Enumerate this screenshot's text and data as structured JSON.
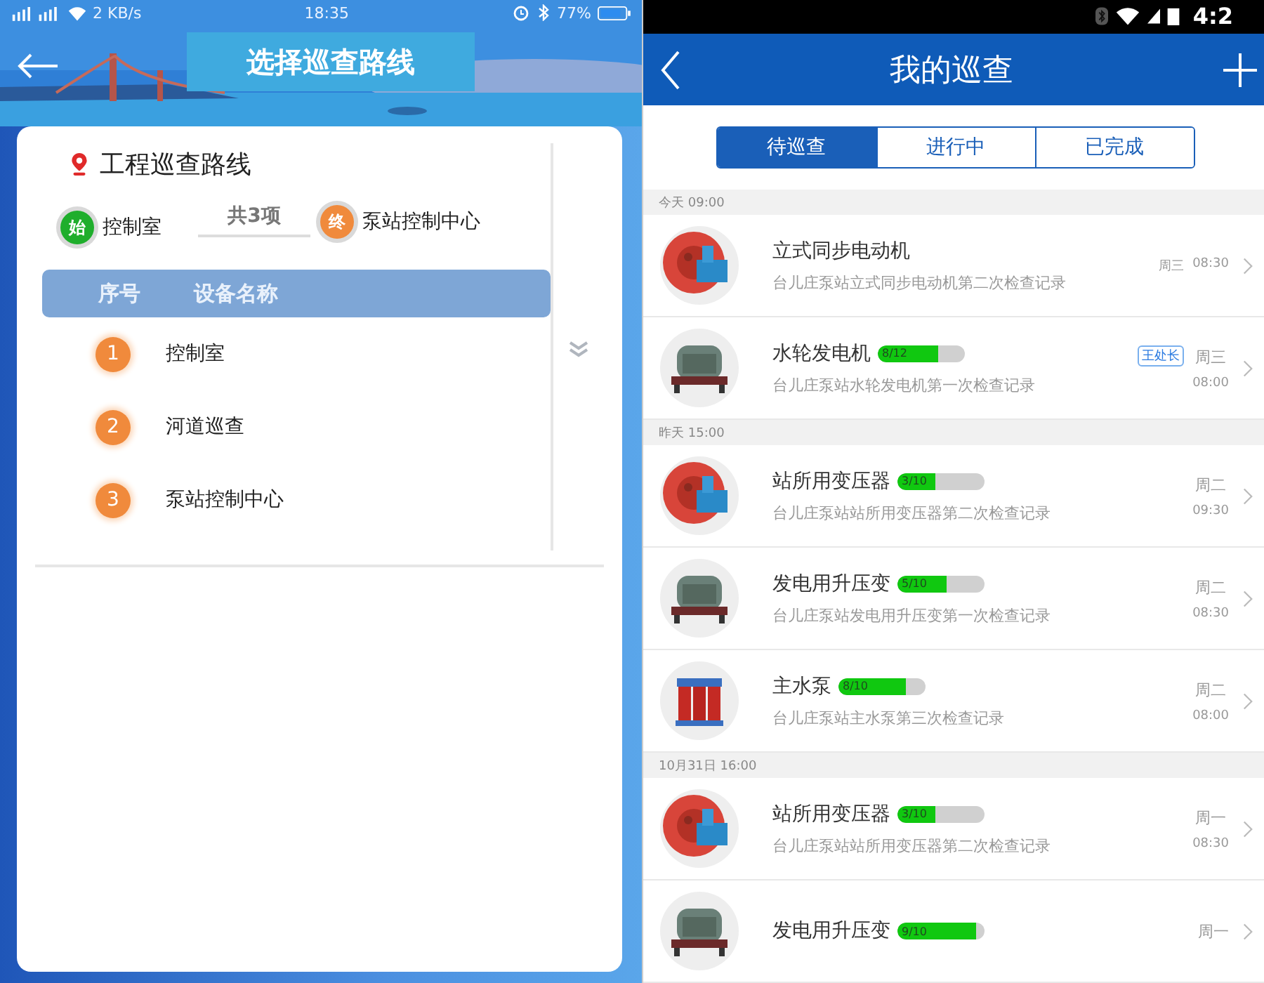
{
  "left_screen": {
    "status_bar": {
      "speed": "2 KB/s",
      "time": "18:35",
      "battery": "77%"
    },
    "title": "选择巡查路线",
    "route_title": "工程巡查路线",
    "start": {
      "badge": "始",
      "name": "控制室"
    },
    "count": "共3项",
    "end": {
      "badge": "终",
      "name": "泵站控制中心"
    },
    "table": {
      "columns": [
        "序号",
        "设备名称"
      ],
      "rows": [
        {
          "index": "1",
          "name": "控制室"
        },
        {
          "index": "2",
          "name": "河道巡查"
        },
        {
          "index": "3",
          "name": "泵站控制中心"
        }
      ]
    }
  },
  "right_screen": {
    "status_bar": {
      "time": "4:2"
    },
    "title": "我的巡查",
    "tabs": [
      {
        "label": "待巡查",
        "selected": true
      },
      {
        "label": "进行中",
        "selected": false
      },
      {
        "label": "已完成",
        "selected": false
      }
    ],
    "groups": [
      {
        "header": "今天 09:00",
        "items": [
          {
            "kind": "inline",
            "title": "立式同步电动机",
            "subtitle": "台儿庄泵站立式同步电动机第二次检查记录",
            "day": "周三",
            "time": "08:30"
          },
          {
            "kind": "stacked",
            "title": "水轮发电机",
            "progress": {
              "text": "8/12",
              "level": 0.7
            },
            "tag": "王处长",
            "subtitle": "台儿庄泵站水轮发电机第一次检查记录",
            "day": "周三",
            "time": "08:00"
          }
        ]
      },
      {
        "header": "昨天 15:00",
        "items": [
          {
            "kind": "stacked",
            "title": "站所用变压器",
            "progress": {
              "text": "3/10",
              "level": 0.43
            },
            "subtitle": "台儿庄泵站站所用变压器第二次检查记录",
            "day": "周二",
            "time": "09:30"
          },
          {
            "kind": "stacked",
            "title": "发电用升压变",
            "progress": {
              "text": "5/10",
              "level": 0.56
            },
            "subtitle": "台儿庄泵站发电用升压变第一次检查记录",
            "day": "周二",
            "time": "08:30"
          },
          {
            "kind": "stacked",
            "title": "主水泵",
            "progress": {
              "text": "8/10",
              "level": 0.78
            },
            "subtitle": "台儿庄泵站主水泵第三次检查记录",
            "day": "周二",
            "time": "08:00"
          }
        ]
      },
      {
        "header": "10月31日 16:00",
        "items": [
          {
            "kind": "stacked",
            "title": "站所用变压器",
            "progress": {
              "text": "3/10",
              "level": 0.43
            },
            "subtitle": "台儿庄泵站站所用变压器第二次检查记录",
            "day": "周一",
            "time": "08:30"
          },
          {
            "kind": "stacked",
            "title": "发电用升压变",
            "progress": {
              "text": "9/10",
              "level": 0.9
            },
            "day": "周一"
          }
        ]
      }
    ]
  }
}
